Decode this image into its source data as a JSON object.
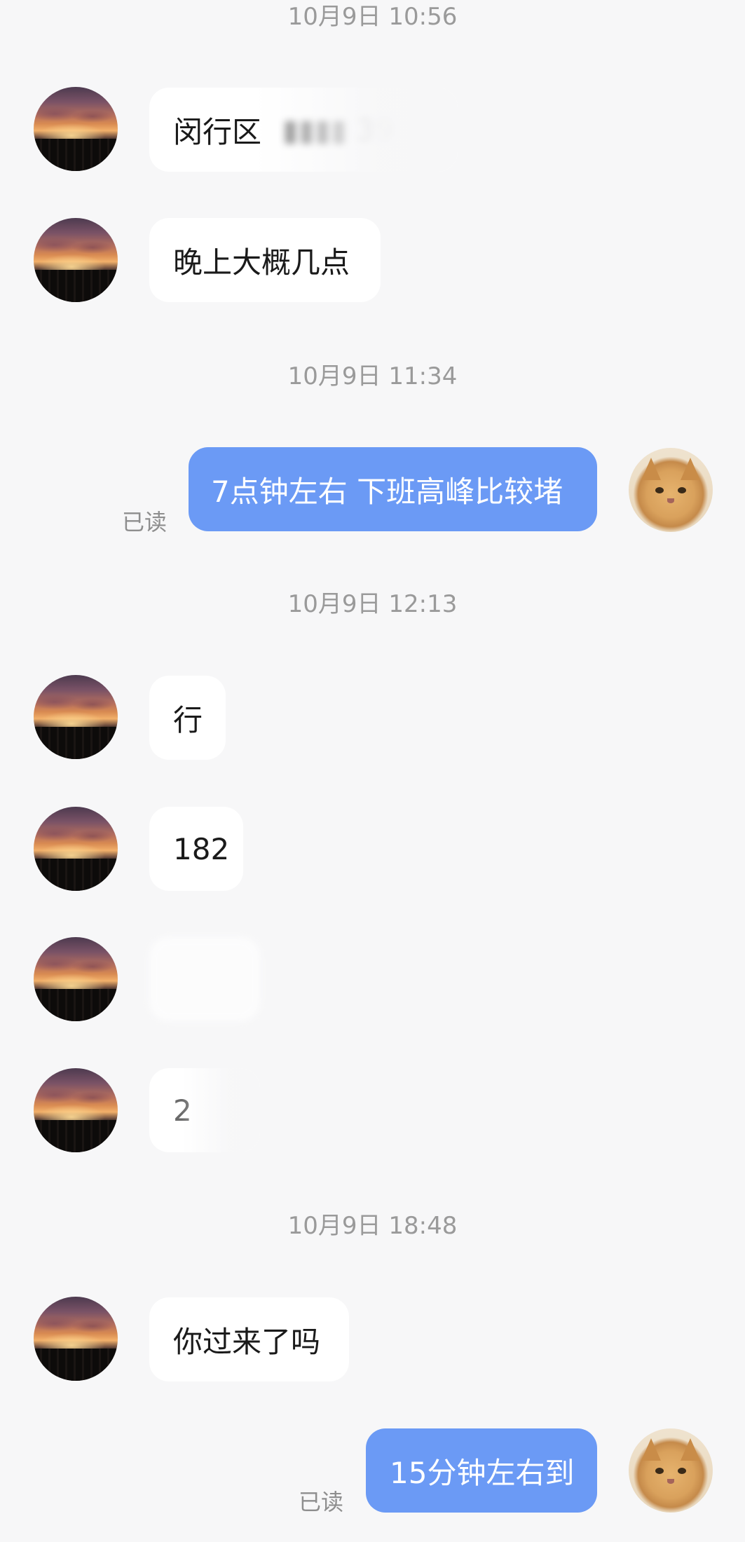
{
  "messages": [
    {
      "type": "timestamp",
      "text": "10月9日 10:56"
    },
    {
      "type": "incoming",
      "text": "闵行区",
      "hidden_tail": "39"
    },
    {
      "type": "incoming",
      "text": "晚上大概几点"
    },
    {
      "type": "timestamp",
      "text": "10月9日 11:34"
    },
    {
      "type": "outgoing",
      "text": "7点钟左右 下班高峰比较堵",
      "status": "已读"
    },
    {
      "type": "timestamp",
      "text": "10月9日 12:13"
    },
    {
      "type": "incoming",
      "text": "行"
    },
    {
      "type": "incoming",
      "text": "182"
    },
    {
      "type": "incoming",
      "text": ""
    },
    {
      "type": "incoming",
      "text": "2"
    },
    {
      "type": "timestamp",
      "text": "10月9日 18:48"
    },
    {
      "type": "incoming",
      "text": "你过来了吗"
    },
    {
      "type": "outgoing",
      "text": "15分钟左右到",
      "status": "已读"
    }
  ],
  "avatars": {
    "contact": "sunset-photo-avatar",
    "self": "orange-cat-avatar"
  },
  "colors": {
    "background": "#f7f7f8",
    "incoming_bubble": "#ffffff",
    "outgoing_bubble": "#6b9af5",
    "timestamp_text": "#9a9a9a"
  }
}
